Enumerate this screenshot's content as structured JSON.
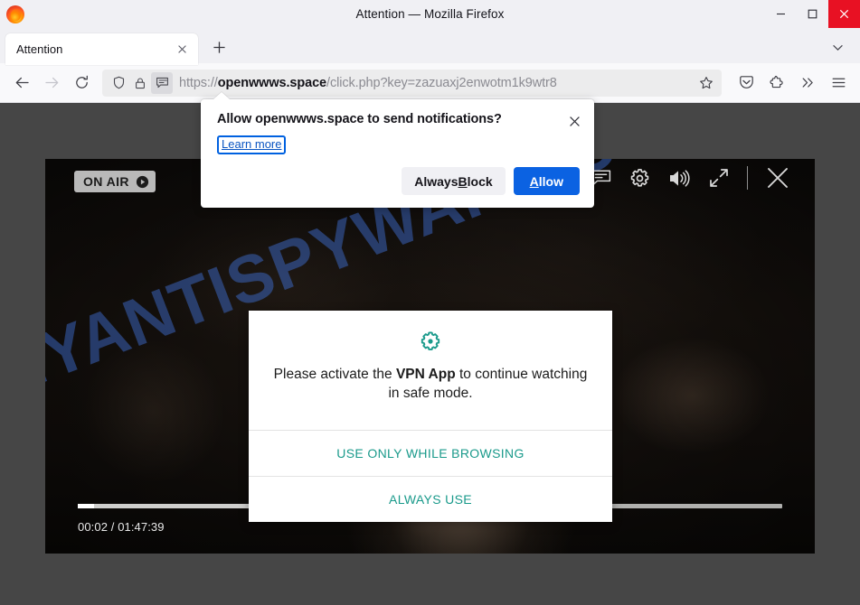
{
  "window": {
    "title": "Attention — Mozilla Firefox",
    "minimize_label": "Minimize",
    "maximize_label": "Maximize",
    "close_label": "Close"
  },
  "tabs": {
    "items": [
      {
        "label": "Attention",
        "close_label": "Close tab"
      }
    ],
    "new_tab_label": "New tab",
    "list_all_label": "List all tabs"
  },
  "toolbar": {
    "back_label": "Go back one page",
    "forward_label": "Go forward one page",
    "reload_label": "Reload current page",
    "pocket_label": "Save to Pocket",
    "extensions_label": "Extensions",
    "overflow_label": "More tools",
    "menu_label": "Open application menu"
  },
  "urlbar": {
    "scheme": "https://",
    "host": "openwwws.space",
    "path": "/click.php?key=zazuaxj2enwotm1k9wtr8",
    "shield_label": "Enhanced Tracking Protection",
    "lock_label": "Connection secure",
    "permission_label": "Site notification permission",
    "bookmark_label": "Bookmark this page"
  },
  "doorhanger": {
    "title": "Allow openwwws.space to send notifications?",
    "learn_more": "Learn more",
    "close_label": "Close",
    "block_prefix": "Always ",
    "block_accesskey": "B",
    "block_suffix": "lock",
    "allow_accesskey": "A",
    "allow_suffix": "llow"
  },
  "player": {
    "onair_label": "ON AIR",
    "subtitles_label": "Subtitles",
    "settings_label": "Settings",
    "volume_label": "Volume",
    "fullscreen_label": "Fullscreen",
    "close_label": "Close player",
    "current_time": "00:02",
    "separator": " / ",
    "duration": "01:47:39",
    "progress_played_percent": 2.3,
    "progress_buffered_percent": 44
  },
  "watermark": {
    "text": "MYANTISPYWARE.COM"
  },
  "vpn_dialog": {
    "message_before": "Please activate the ",
    "message_bold": "VPN App",
    "message_after": " to continue watching in safe mode.",
    "action_primary": "USE ONLY WHILE BROWSING",
    "action_secondary": "ALWAYS USE",
    "accent_color": "#1a9a8b"
  }
}
